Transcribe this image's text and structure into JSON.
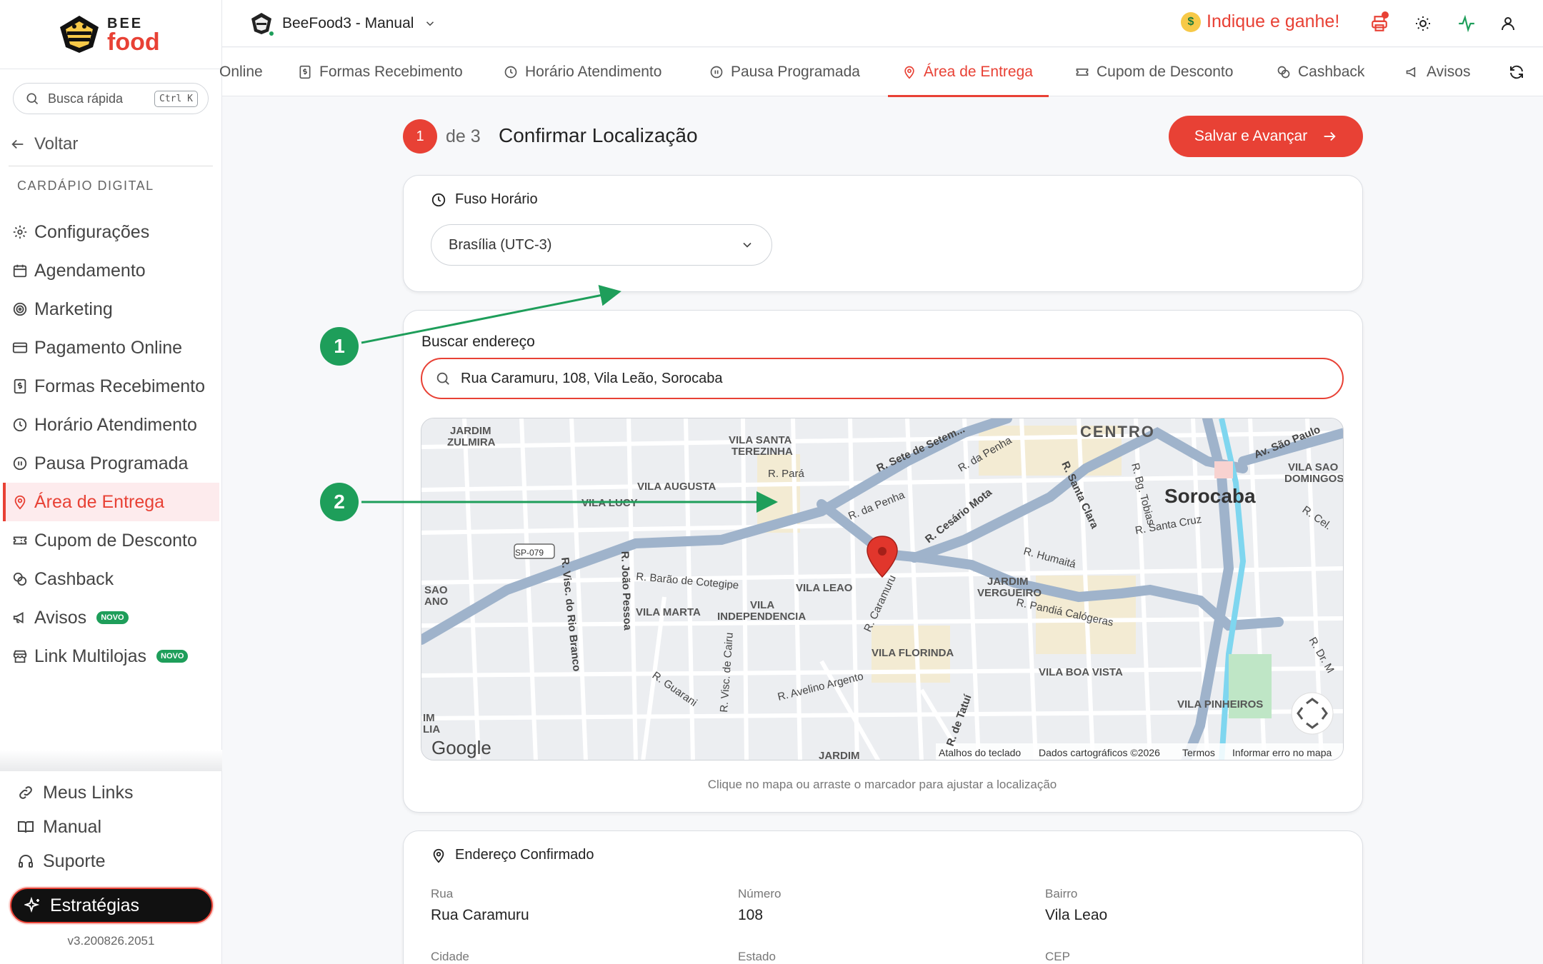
{
  "brand": {
    "bee": "BEE",
    "food": "food"
  },
  "sidebar": {
    "search_label": "Busca rápida",
    "search_shortcut": "Ctrl K",
    "back_label": "Voltar",
    "section_title": "CARDÁPIO DIGITAL",
    "items": [
      {
        "label": "Configurações",
        "icon": "gear-icon"
      },
      {
        "label": "Agendamento",
        "icon": "calendar-icon"
      },
      {
        "label": "Marketing",
        "icon": "target-icon"
      },
      {
        "label": "Pagamento Online",
        "icon": "credit-card-icon"
      },
      {
        "label": "Formas Recebimento",
        "icon": "dollar-receipt-icon"
      },
      {
        "label": "Horário Atendimento",
        "icon": "clock-icon"
      },
      {
        "label": "Pausa Programada",
        "icon": "pause-icon"
      },
      {
        "label": "Área de Entrega",
        "icon": "map-pin-icon",
        "active": true
      },
      {
        "label": "Cupom de Desconto",
        "icon": "ticket-icon"
      },
      {
        "label": "Cashback",
        "icon": "coins-icon"
      },
      {
        "label": "Avisos",
        "icon": "megaphone-icon",
        "badge": "NOVO"
      },
      {
        "label": "Link Multilojas",
        "icon": "store-icon",
        "badge": "NOVO"
      }
    ],
    "bottom_items": [
      {
        "label": "Meus Links",
        "icon": "link-icon"
      },
      {
        "label": "Manual",
        "icon": "book-icon"
      },
      {
        "label": "Suporte",
        "icon": "headset-icon"
      }
    ],
    "strategies_label": "Estratégias",
    "version": "v3.200826.2051"
  },
  "topbar": {
    "store_name": "BeeFood3 - Manual",
    "indique_label": "Indique e ganhe!"
  },
  "tabs": [
    {
      "label": "Online",
      "icon": "credit-card-icon"
    },
    {
      "label": "Formas Recebimento",
      "icon": "dollar-receipt-icon"
    },
    {
      "label": "Horário Atendimento",
      "icon": "clock-icon"
    },
    {
      "label": "Pausa Programada",
      "icon": "pause-icon"
    },
    {
      "label": "Área de Entrega",
      "icon": "map-pin-icon",
      "active": true
    },
    {
      "label": "Cupom de Desconto",
      "icon": "ticket-icon"
    },
    {
      "label": "Cashback",
      "icon": "coins-icon"
    },
    {
      "label": "Avisos",
      "icon": "megaphone-icon"
    }
  ],
  "step": {
    "number": "1",
    "of": "de 3",
    "title": "Confirmar Localização",
    "save_label": "Salvar e Avançar"
  },
  "timezone": {
    "title": "Fuso Horário",
    "selected": "Brasília (UTC-3)"
  },
  "address_search": {
    "label": "Buscar endereço",
    "value": "Rua Caramuru, 108, Vila Leão, Sorocaba"
  },
  "map": {
    "hint": "Clique no mapa ou arraste o marcador para ajustar a localização",
    "google": "Google",
    "footer": [
      "Atalhos do teclado",
      "Dados cartográficos ©2026",
      "Termos",
      "Informar erro no mapa"
    ],
    "labels": {
      "centro": "CENTRO",
      "sorocaba": "Sorocaba",
      "vila_augusta": "VILA AUGUSTA",
      "vila_lucy": "VILA LUCY",
      "vila_santa_terezinha_1": "VILA SANTA",
      "vila_santa_terezinha_2": "TEREZINHA",
      "jardim_zulmira_1": "JARDIM",
      "jardim_zulmira_2": "ZULMIRA",
      "vila_leao": "VILA LEAO",
      "vila_marta": "VILA MARTA",
      "vila_independencia_1": "VILA",
      "vila_independencia_2": "INDEPENDENCIA",
      "vila_florinda": "VILA FLORINDA",
      "jardim_vergueiro_1": "JARDIM",
      "jardim_vergueiro_2": "VERGUEIRO",
      "vila_boa_vista": "VILA BOA VISTA",
      "vila_pinheiros": "VILA PINHEIROS",
      "vila_sao_domingos_1": "VILA SAO",
      "vila_sao_domingos_2": "DOMINGOS",
      "sp079": "SP-079",
      "r_para": "R. Pará",
      "r_da_penha": "R. da Penha",
      "r_da_penha2": "R. da Penha",
      "r_sete": "R. Sete de Setem...",
      "r_cesario": "R. Cesário Mota",
      "r_santa_clara": "R. Santa Clara",
      "r_santa_cruz": "R. Santa Cruz",
      "r_humaita": "R. Humaitá",
      "r_pandia": "R. Pandiá Calógeras",
      "r_barao": "R. Barão de Cotegipe",
      "r_caramuru": "R. Caramuru",
      "r_avelino": "R. Avelino Argento",
      "r_guarani": "R. Guarani",
      "r_visc_rio_branco": "R. Visc. do Rio Branco",
      "r_joao_pessoa": "R. João Pessoa",
      "r_visc_cairu": "R. Visc. de Cairu",
      "r_bg_tobias": "R. Bg. Tobias",
      "av_sao_paulo": "Av. São Paulo",
      "r_cel": "R. Cel.",
      "r_dr": "R. Dr. M",
      "r_de_tatui": "R. de Tatuí",
      "jardim_bottom": "JARDIM",
      "sao_ano_1": "SAO",
      "sao_ano_2": "ANO",
      "im_lia_1": "IM",
      "im_lia_2": "LIA"
    }
  },
  "confirmed": {
    "title": "Endereço Confirmado",
    "fields": [
      {
        "label": "Rua",
        "value": "Rua Caramuru"
      },
      {
        "label": "Número",
        "value": "108"
      },
      {
        "label": "Bairro",
        "value": "Vila Leao"
      },
      {
        "label": "Cidade",
        "value": ""
      },
      {
        "label": "Estado",
        "value": ""
      },
      {
        "label": "CEP",
        "value": ""
      }
    ]
  },
  "annotations": [
    "1",
    "2"
  ],
  "colors": {
    "accent": "#e84135",
    "annotation": "#1e9e5a",
    "active_bg": "#fdebed"
  }
}
